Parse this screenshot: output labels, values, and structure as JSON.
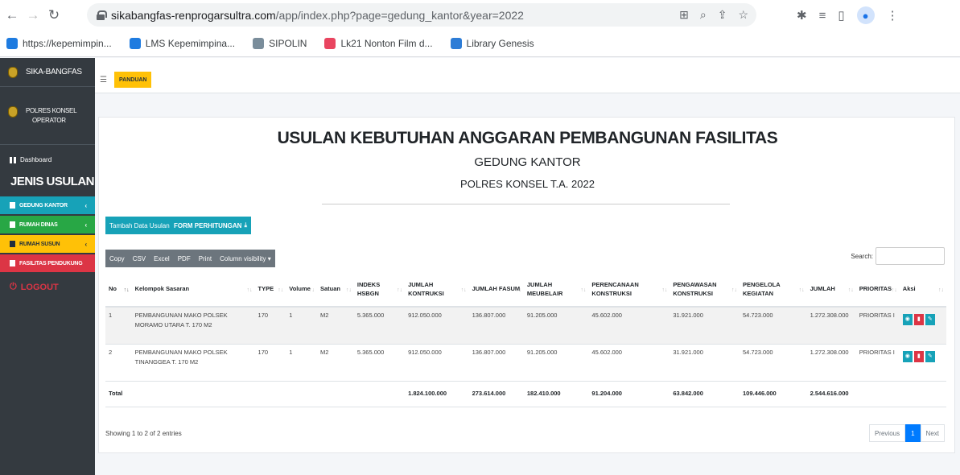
{
  "browser": {
    "url_host": "sikabangfas-renprogarsultra.com",
    "url_path": "/app/index.php?page=gedung_kantor&year=2022",
    "bookmarks": [
      {
        "label": "https://kepemimpin...",
        "color": "#1e7be0"
      },
      {
        "label": "LMS Kepemimpina...",
        "color": "#1e7be0"
      },
      {
        "label": "SIPOLIN",
        "color": "#7a8d9b"
      },
      {
        "label": "Lk21 Nonton Film d...",
        "color": "#e94560"
      },
      {
        "label": "Library Genesis",
        "color": "#2d7cd6"
      }
    ]
  },
  "sidebar": {
    "brand": "SIKA-BANGFAS",
    "user_line1": "POLRES KONSEL",
    "user_line2": "OPERATOR",
    "dashboard": "Dashboard",
    "section": "JENIS USULAN",
    "items": [
      {
        "label": "GEDUNG KANTOR",
        "color": "#17a2b8"
      },
      {
        "label": "RUMAH DINAS",
        "color": "#28a745"
      },
      {
        "label": "RUMAH SUSUN",
        "color": "#ffc107"
      },
      {
        "label": "FASILITAS PENDUKUNG",
        "color": "#dc3545"
      }
    ],
    "logout": "LOGOUT"
  },
  "topnav": {
    "panduan": "PANDUAN"
  },
  "page": {
    "title": "USULAN KEBUTUHAN ANGGARAN PEMBANGUNAN FASILITAS",
    "subtitle": "GEDUNG KANTOR",
    "subtitle2": "POLRES KONSEL T.A. 2022",
    "btn_add": "Tambah Data Usulan",
    "btn_form": "FORM PERHITUNGAN",
    "export": [
      "Copy",
      "CSV",
      "Excel",
      "PDF",
      "Print",
      "Column visibility ▾"
    ],
    "search_label": "Search:"
  },
  "table": {
    "headers": [
      "No",
      "Kelompok Sasaran",
      "TYPE",
      "Volume",
      "Satuan",
      "INDEKS HSBGN",
      "JUMLAH KONTRUKSI",
      "JUMLAH FASUM",
      "JUMLAH MEUBELAIR",
      "PERENCANAAN KONSTRUKSI",
      "PENGAWASAN KONSTRUKSI",
      "PENGELOLA KEGIATAN",
      "JUMLAH",
      "PRIORITAS",
      "Aksi"
    ],
    "rows": [
      [
        "1",
        "PEMBANGUNAN MAKO POLSEK MORAMO UTARA T. 170 M2",
        "170",
        "1",
        "M2",
        "5.365.000",
        "912.050.000",
        "136.807.000",
        "91.205.000",
        "45.602.000",
        "31.921.000",
        "54.723.000",
        "1.272.308.000",
        "PRIORITAS I"
      ],
      [
        "2",
        "PEMBANGUNAN MAKO POLSEK TINANGGEA T. 170 M2",
        "170",
        "1",
        "M2",
        "5.365.000",
        "912.050.000",
        "136.807.000",
        "91.205.000",
        "45.602.000",
        "31.921.000",
        "54.723.000",
        "1.272.308.000",
        "PRIORITAS I"
      ]
    ],
    "total_label": "Total",
    "totals": [
      "1.824.100.000",
      "273.614.000",
      "182.410.000",
      "91.204.000",
      "63.842.000",
      "109.446.000",
      "2.544.616.000"
    ]
  },
  "footer": {
    "showing": "Showing 1 to 2 of 2 entries",
    "prev": "Previous",
    "page": "1",
    "next": "Next"
  }
}
